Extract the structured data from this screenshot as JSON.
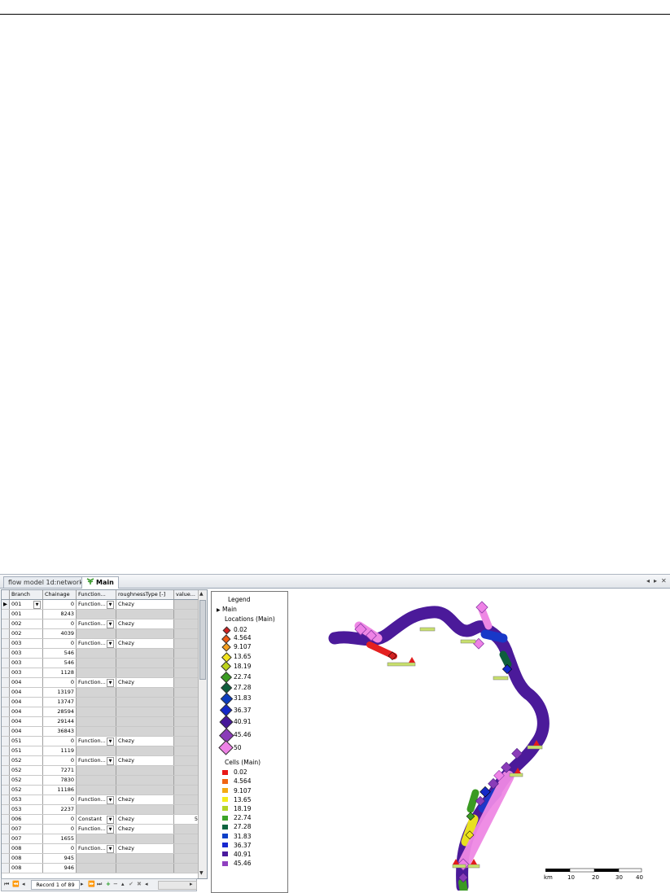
{
  "window": {
    "tabs": [
      {
        "label": "flow model 1d:network",
        "active": false
      },
      {
        "label": "Main",
        "active": true
      }
    ]
  },
  "grid": {
    "columns": [
      "Branch",
      "Chainage",
      "Function...",
      "roughnessType [-]",
      "value..."
    ],
    "rows": [
      {
        "branch": "001",
        "chainage": "0",
        "func": "Function...",
        "type": "Chezy",
        "value": "",
        "current": true,
        "branch_dd": true
      },
      {
        "branch": "001",
        "chainage": "8243",
        "func": "",
        "type": "",
        "value": ""
      },
      {
        "branch": "002",
        "chainage": "0",
        "func": "Function...",
        "type": "Chezy",
        "value": ""
      },
      {
        "branch": "002",
        "chainage": "4039",
        "func": "",
        "type": "",
        "value": ""
      },
      {
        "branch": "003",
        "chainage": "0",
        "func": "Function...",
        "type": "Chezy",
        "value": ""
      },
      {
        "branch": "003",
        "chainage": "546",
        "func": "",
        "type": "",
        "value": ""
      },
      {
        "branch": "003",
        "chainage": "546",
        "func": "",
        "type": "",
        "value": ""
      },
      {
        "branch": "003",
        "chainage": "1128",
        "func": "",
        "type": "",
        "value": ""
      },
      {
        "branch": "004",
        "chainage": "0",
        "func": "Function...",
        "type": "Chezy",
        "value": ""
      },
      {
        "branch": "004",
        "chainage": "13197",
        "func": "",
        "type": "",
        "value": ""
      },
      {
        "branch": "004",
        "chainage": "13747",
        "func": "",
        "type": "",
        "value": ""
      },
      {
        "branch": "004",
        "chainage": "28594",
        "func": "",
        "type": "",
        "value": ""
      },
      {
        "branch": "004",
        "chainage": "29144",
        "func": "",
        "type": "",
        "value": ""
      },
      {
        "branch": "004",
        "chainage": "36843",
        "func": "",
        "type": "",
        "value": ""
      },
      {
        "branch": "051",
        "chainage": "0",
        "func": "Function...",
        "type": "Chezy",
        "value": ""
      },
      {
        "branch": "051",
        "chainage": "1119",
        "func": "",
        "type": "",
        "value": ""
      },
      {
        "branch": "052",
        "chainage": "0",
        "func": "Function...",
        "type": "Chezy",
        "value": ""
      },
      {
        "branch": "052",
        "chainage": "7271",
        "func": "",
        "type": "",
        "value": ""
      },
      {
        "branch": "052",
        "chainage": "7830",
        "func": "",
        "type": "",
        "value": ""
      },
      {
        "branch": "052",
        "chainage": "11186",
        "func": "",
        "type": "",
        "value": ""
      },
      {
        "branch": "053",
        "chainage": "0",
        "func": "Function...",
        "type": "Chezy",
        "value": ""
      },
      {
        "branch": "053",
        "chainage": "2237",
        "func": "",
        "type": "",
        "value": ""
      },
      {
        "branch": "006",
        "chainage": "0",
        "func": "Constant",
        "type": "Chezy",
        "value": "5"
      },
      {
        "branch": "007",
        "chainage": "0",
        "func": "Function...",
        "type": "Chezy",
        "value": ""
      },
      {
        "branch": "007",
        "chainage": "1655",
        "func": "",
        "type": "",
        "value": ""
      },
      {
        "branch": "008",
        "chainage": "0",
        "func": "Function...",
        "type": "Chezy",
        "value": ""
      },
      {
        "branch": "008",
        "chainage": "945",
        "func": "",
        "type": "",
        "value": ""
      },
      {
        "branch": "008",
        "chainage": "946",
        "func": "",
        "type": "",
        "value": ""
      }
    ],
    "record_label": "Record 1 of 89"
  },
  "legend": {
    "title": "Legend",
    "layer": "Main",
    "locations_title": "Locations (Main)",
    "cells_title": "Cells (Main)",
    "locations": [
      {
        "label": "0.02",
        "color": "#d42020"
      },
      {
        "label": "4.564",
        "color": "#f05a14"
      },
      {
        "label": "9.107",
        "color": "#f4a020"
      },
      {
        "label": "13.65",
        "color": "#f2e41c"
      },
      {
        "label": "18.19",
        "color": "#bcd41c"
      },
      {
        "label": "22.74",
        "color": "#3a9c22"
      },
      {
        "label": "27.28",
        "color": "#0e5e3c"
      },
      {
        "label": "31.83",
        "color": "#0c3cbe"
      },
      {
        "label": "36.37",
        "color": "#1428c8"
      },
      {
        "label": "40.91",
        "color": "#46189a"
      },
      {
        "label": "45.46",
        "color": "#8a3cb8"
      },
      {
        "label": "50",
        "color": "#ee82e6"
      }
    ],
    "cells": [
      {
        "label": "0.02",
        "color": "#e81818"
      },
      {
        "label": "4.564",
        "color": "#f06414"
      },
      {
        "label": "9.107",
        "color": "#f4aa14"
      },
      {
        "label": "13.65",
        "color": "#f4ec1c"
      },
      {
        "label": "18.19",
        "color": "#b4d428"
      },
      {
        "label": "22.74",
        "color": "#3ca428"
      },
      {
        "label": "27.28",
        "color": "#0c6440"
      },
      {
        "label": "31.83",
        "color": "#0c40c8"
      },
      {
        "label": "36.37",
        "color": "#1828d0"
      },
      {
        "label": "40.91",
        "color": "#4a1a9e"
      },
      {
        "label": "45.46",
        "color": "#9040c0"
      }
    ]
  },
  "scalebar": {
    "unit": "km",
    "ticks": [
      "10",
      "20",
      "30",
      "40"
    ]
  }
}
